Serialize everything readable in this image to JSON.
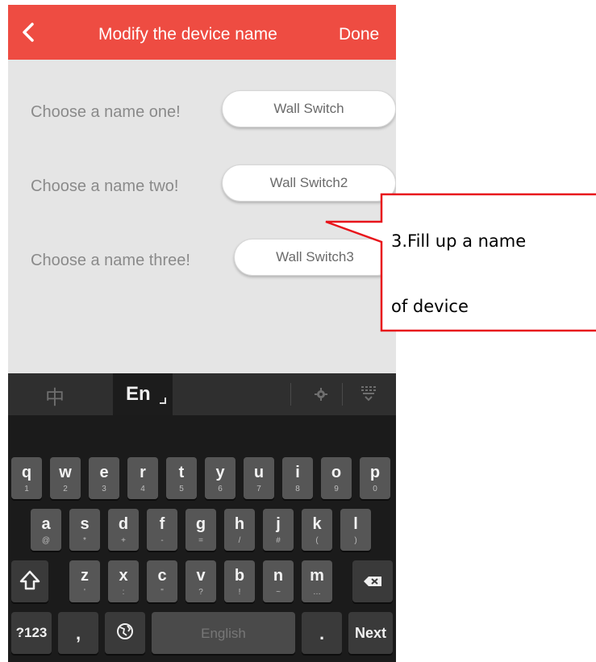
{
  "header": {
    "title": "Modify the device name",
    "done_label": "Done"
  },
  "form": {
    "rows": [
      {
        "label": "Choose a name one!",
        "value": "Wall Switch"
      },
      {
        "label": "Choose a name two!",
        "value": "Wall Switch2"
      },
      {
        "label": "Choose a name three!",
        "value": "Wall Switch3"
      }
    ]
  },
  "keyboard": {
    "lang_chinese": "中",
    "lang_english": "En",
    "row1": [
      {
        "k": "q",
        "s": "1"
      },
      {
        "k": "w",
        "s": "2"
      },
      {
        "k": "e",
        "s": "3"
      },
      {
        "k": "r",
        "s": "4"
      },
      {
        "k": "t",
        "s": "5"
      },
      {
        "k": "y",
        "s": "6"
      },
      {
        "k": "u",
        "s": "7"
      },
      {
        "k": "i",
        "s": "8"
      },
      {
        "k": "o",
        "s": "9"
      },
      {
        "k": "p",
        "s": "0"
      }
    ],
    "row2": [
      {
        "k": "a",
        "s": "@"
      },
      {
        "k": "s",
        "s": "*"
      },
      {
        "k": "d",
        "s": "+"
      },
      {
        "k": "f",
        "s": "-"
      },
      {
        "k": "g",
        "s": "="
      },
      {
        "k": "h",
        "s": "/"
      },
      {
        "k": "j",
        "s": "#"
      },
      {
        "k": "k",
        "s": "("
      },
      {
        "k": "l",
        "s": ")"
      }
    ],
    "row3": [
      {
        "k": "z",
        "s": "'"
      },
      {
        "k": "x",
        "s": ":"
      },
      {
        "k": "c",
        "s": "\""
      },
      {
        "k": "v",
        "s": "?"
      },
      {
        "k": "b",
        "s": "!"
      },
      {
        "k": "n",
        "s": "~"
      },
      {
        "k": "m",
        "s": "…"
      }
    ],
    "symbols_label": "?123",
    "comma_label": ",",
    "space_label": "English",
    "period_label": ".",
    "next_label": "Next"
  },
  "annotation": {
    "line1": "3.Fill  up  a  name",
    "line2": "of device",
    "border_color": "#e8141b"
  },
  "colors": {
    "header": "#ee4c42",
    "background": "#e5e5e5",
    "keyboard": "#1b1b1b"
  }
}
